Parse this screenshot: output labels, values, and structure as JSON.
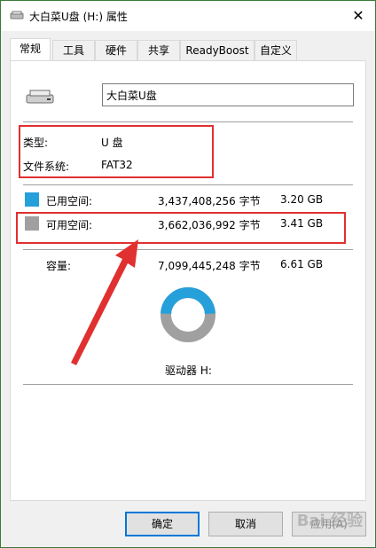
{
  "window": {
    "title": "大白菜U盘 (H:) 属性",
    "close_glyph": "✕"
  },
  "tabs": [
    {
      "label": "常规",
      "active": true
    },
    {
      "label": "工具",
      "active": false
    },
    {
      "label": "硬件",
      "active": false
    },
    {
      "label": "共享",
      "active": false
    },
    {
      "label": "ReadyBoost",
      "active": false
    },
    {
      "label": "自定义",
      "active": false
    }
  ],
  "general": {
    "drive_name_value": "大白菜U盘",
    "type_label": "类型:",
    "type_value": "U 盘",
    "filesystem_label": "文件系统:",
    "filesystem_value": "FAT32",
    "used": {
      "label": "已用空间:",
      "bytes": "3,437,408,256 字节",
      "size": "3.20 GB",
      "color": "#26a0da"
    },
    "free": {
      "label": "可用空间:",
      "bytes": "3,662,036,992 字节",
      "size": "3.41 GB",
      "color": "#a0a0a0"
    },
    "capacity": {
      "label": "容量:",
      "bytes": "7,099,445,248 字节",
      "size": "6.61 GB"
    },
    "drive_label": "驱动器 H:",
    "used_fraction": 0.484
  },
  "buttons": {
    "ok": "确定",
    "cancel": "取消",
    "apply": "应用(A)"
  },
  "watermark": "Bai 经验"
}
